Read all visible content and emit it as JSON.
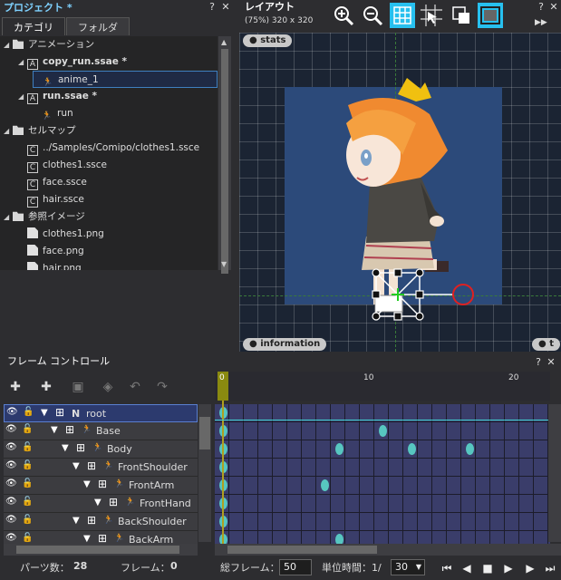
{
  "project": {
    "title": "プロジェクト *",
    "tabs": [
      "カテゴリ",
      "フォルダ"
    ],
    "tree": [
      {
        "label": "アニメーション",
        "icon": "folder-icon",
        "level": 0,
        "arrow": "◢"
      },
      {
        "label": "copy_run.ssae *",
        "icon": "animation-file-icon",
        "level": 1,
        "arrow": "◢",
        "bold": true
      },
      {
        "label": "anime_1",
        "icon": "runner-icon",
        "level": 2,
        "selected": true
      },
      {
        "label": "run.ssae *",
        "icon": "animation-file-icon",
        "level": 1,
        "arrow": "◢",
        "bold": true
      },
      {
        "label": "run",
        "icon": "runner-icon",
        "level": 2
      },
      {
        "label": "セルマップ",
        "icon": "folder-icon",
        "level": 0,
        "arrow": "◢"
      },
      {
        "label": "../Samples/Comipo/clothes1.ssce",
        "icon": "cellmap-file-icon",
        "level": 1
      },
      {
        "label": "clothes1.ssce",
        "icon": "cellmap-file-icon",
        "level": 1
      },
      {
        "label": "face.ssce",
        "icon": "cellmap-file-icon",
        "level": 1
      },
      {
        "label": "hair.ssce",
        "icon": "cellmap-file-icon",
        "level": 1
      },
      {
        "label": "参照イメージ",
        "icon": "folder-icon",
        "level": 0,
        "arrow": "◢"
      },
      {
        "label": "clothes1.png",
        "icon": "image-file-icon",
        "level": 1
      },
      {
        "label": "face.png",
        "icon": "image-file-icon",
        "level": 1
      },
      {
        "label": "hair.png",
        "icon": "image-file-icon",
        "level": 1
      }
    ]
  },
  "layout": {
    "title": "レイアウト",
    "subtitle": "(75%) 320 x 320",
    "label_stats": "● stats",
    "label_information": "● information",
    "label_t": "● t"
  },
  "frame": {
    "title": "フレーム コントロール",
    "ruler": [
      "0",
      "10",
      "20"
    ],
    "parts": [
      {
        "name": "root",
        "indent": 0,
        "prefix": "N"
      },
      {
        "name": "Base",
        "indent": 1
      },
      {
        "name": "Body",
        "indent": 2
      },
      {
        "name": "FrontShoulder",
        "indent": 3
      },
      {
        "name": "FrontArm",
        "indent": 4
      },
      {
        "name": "FrontHand",
        "indent": 5
      },
      {
        "name": "BackShoulder",
        "indent": 3
      },
      {
        "name": "BackArm",
        "indent": 4
      }
    ],
    "keyframes": [
      [
        0
      ],
      [
        0,
        11
      ],
      [
        0,
        8,
        13,
        17
      ],
      [
        0
      ],
      [
        0,
        7
      ],
      [
        0
      ],
      [
        0
      ],
      [
        0,
        8
      ]
    ]
  },
  "status": {
    "parts_label": "パーツ数：",
    "parts_count": "28",
    "frame_label": "フレーム：",
    "frame_value": "0",
    "total_label": "総フレーム：",
    "total_value": "50",
    "unit_label": "単位時間：1/",
    "unit_value": "30"
  }
}
